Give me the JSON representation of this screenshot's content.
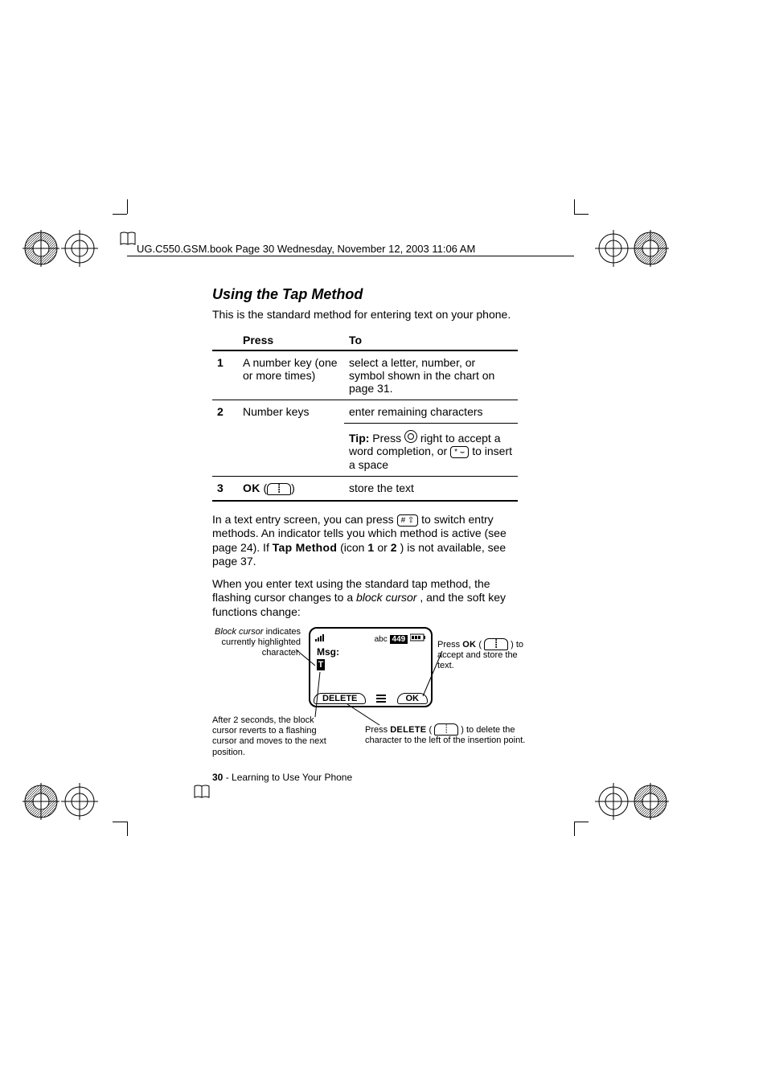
{
  "header": {
    "running": "UG.C550.GSM.book  Page 30  Wednesday, November 12, 2003  11:06 AM"
  },
  "section": {
    "title": "Using the Tap Method",
    "intro": "This is the standard method for entering text on your phone."
  },
  "table": {
    "head_press": "Press",
    "head_to": "To",
    "rows": [
      {
        "n": "1",
        "press": "A number key (one or more times)",
        "to": "select a letter, number, or symbol shown in the chart on page 31."
      },
      {
        "n": "2",
        "press": "Number keys",
        "to_line1": "enter remaining characters",
        "tip_prefix": "Tip:",
        "tip_1": " Press ",
        "tip_2": " right to accept a word completion, or ",
        "tip_3": " to insert a space",
        "star_key": "* ⌣"
      },
      {
        "n": "3",
        "press_bold": "OK",
        "press_key": "",
        "to": "store the text"
      }
    ]
  },
  "para1_a": "In a text entry screen, you can press ",
  "para1_b": " to switch entry methods. An indicator tells you which method is active (see page 24). If ",
  "para1_tapmethod": "Tap Method",
  "para1_c": " (icon ",
  "para1_icon1": "1",
  "para1_d": " or ",
  "para1_icon2": "2",
  "para1_e": ") is not available, see page 37.",
  "para2_a": "When you enter text using the standard tap method, the flashing cursor changes to a ",
  "para2_ital": "block cursor",
  "para2_b": ", and the soft key functions change:",
  "phone": {
    "status_left": "📶",
    "status_abc": "abc",
    "status_badge": "449",
    "status_batt": "▮▮▮",
    "msg": "Msg:",
    "cursor": "T",
    "sk_left": "DELETE",
    "sk_right": "OK"
  },
  "callouts": {
    "left_ital": "Block cursor",
    "left_rest": " indicates currently highlighted character.",
    "right_a": "Press ",
    "right_ok": "OK",
    "right_b": " (",
    "right_c": ") to accept and store the text.",
    "bl": "After 2 seconds, the block cursor reverts to a flashing cursor and moves to the next position.",
    "br_a": "Press ",
    "br_del": "DELETE",
    "br_b": " (",
    "br_c": ") to delete the character to the left of the insertion point."
  },
  "footer": {
    "page": "30",
    "chapter": " - Learning to Use Your Phone"
  }
}
